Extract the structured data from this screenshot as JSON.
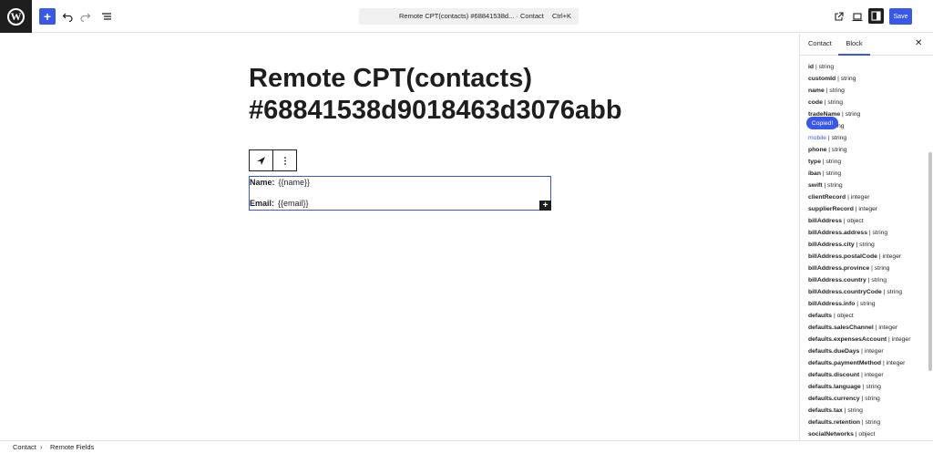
{
  "toolbar": {
    "document_title": "Remote CPT(contacts) #68841538d... · Contact",
    "shortcut": "Ctrl+K",
    "save_label": "Save",
    "inserter_symbol": "+",
    "logo_letter": "W"
  },
  "canvas": {
    "post_title": "Remote CPT(contacts) #68841538d9018463d3076abb",
    "fields": [
      {
        "label": "Name:",
        "value": "{{name}}"
      },
      {
        "label": "Email:",
        "value": "{{email}}"
      }
    ],
    "add_block_symbol": "+"
  },
  "sidebar": {
    "tabs": [
      "Contact",
      "Block"
    ],
    "active_tab": "Block",
    "close_symbol": "✕",
    "tooltip": "Copied!",
    "fields": [
      {
        "name": "id",
        "type": "| string"
      },
      {
        "name": "customId",
        "type": "| string"
      },
      {
        "name": "name",
        "type": "| string"
      },
      {
        "name": "code",
        "type": "| string"
      },
      {
        "name": "tradeName",
        "type": "| string"
      },
      {
        "name": "email",
        "type": "| string"
      },
      {
        "name": "mobile",
        "type": "| string",
        "active": true
      },
      {
        "name": "phone",
        "type": "| string"
      },
      {
        "name": "type",
        "type": "| string"
      },
      {
        "name": "iban",
        "type": "| string"
      },
      {
        "name": "swift",
        "type": "| string"
      },
      {
        "name": "clientRecord",
        "type": "| integer"
      },
      {
        "name": "supplierRecord",
        "type": "| integer"
      },
      {
        "name": "billAddress",
        "type": "| object"
      },
      {
        "name": "billAddress.address",
        "type": "| string"
      },
      {
        "name": "billAddress.city",
        "type": "| string"
      },
      {
        "name": "billAddress.postalCode",
        "type": "| integer"
      },
      {
        "name": "billAddress.province",
        "type": "| string"
      },
      {
        "name": "billAddress.country",
        "type": "| string"
      },
      {
        "name": "billAddress.countryCode",
        "type": "| string"
      },
      {
        "name": "billAddress.info",
        "type": "| string"
      },
      {
        "name": "defaults",
        "type": "| object"
      },
      {
        "name": "defaults.salesChannel",
        "type": "| integer"
      },
      {
        "name": "defaults.expensesAccount",
        "type": "| integer"
      },
      {
        "name": "defaults.dueDays",
        "type": "| integer"
      },
      {
        "name": "defaults.paymentMethod",
        "type": "| integer"
      },
      {
        "name": "defaults.discount",
        "type": "| integer"
      },
      {
        "name": "defaults.language",
        "type": "| string"
      },
      {
        "name": "defaults.currency",
        "type": "| string"
      },
      {
        "name": "defaults.tax",
        "type": "| string"
      },
      {
        "name": "defaults.retention",
        "type": "| string"
      },
      {
        "name": "socialNetworks",
        "type": "| object"
      }
    ]
  },
  "breadcrumb": {
    "items": [
      "Contact",
      "Remote Fields"
    ],
    "separator": "›"
  },
  "icons": {
    "wordpress": "wordpress-logo-icon",
    "undo": "undo-icon",
    "redo": "redo-icon",
    "list_view": "list-view-icon",
    "view": "external-view-icon",
    "device": "device-preview-icon",
    "settings": "settings-sidebar-icon",
    "block": "airplane-block-icon",
    "more": "more-vertical-icon"
  },
  "colors": {
    "accent": "#3858e9",
    "dark": "#1e1e1e"
  }
}
